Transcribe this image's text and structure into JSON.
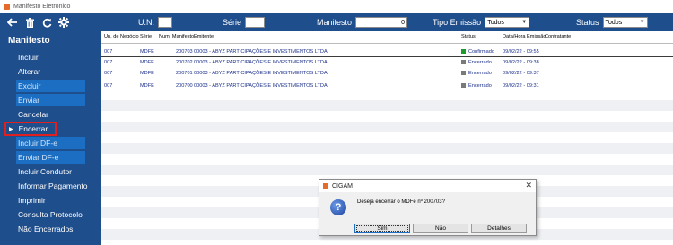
{
  "window": {
    "title": "Manifesto Eletrônico"
  },
  "toolbar": {
    "icons": [
      "back-arrow-icon",
      "trash-icon",
      "refresh-icon",
      "gear-icon"
    ],
    "un_label": "U.N.",
    "un_value": "",
    "serie_label": "Série",
    "serie_value": "",
    "manifesto_label": "Manifesto",
    "manifesto_value": "0",
    "tipo_label": "Tipo Emissão",
    "tipo_value": "Todos",
    "status_label": "Status",
    "status_value": "Todos",
    "accent_color": "#1f4e8c"
  },
  "sidebar": {
    "heading": "Manifesto",
    "items": [
      {
        "label": "Incluir",
        "state": "enabled"
      },
      {
        "label": "Alterar",
        "state": "enabled"
      },
      {
        "label": "Excluir",
        "state": "disabled"
      },
      {
        "label": "Enviar",
        "state": "disabled"
      },
      {
        "label": "Cancelar",
        "state": "enabled"
      },
      {
        "label": "Encerrar",
        "state": "active"
      },
      {
        "label": "Incluir DF-e",
        "state": "disabled"
      },
      {
        "label": "Enviar DF-e",
        "state": "disabled"
      },
      {
        "label": "Incluir Condutor",
        "state": "enabled"
      },
      {
        "label": "Informar Pagamento",
        "state": "enabled"
      },
      {
        "label": "Imprimir",
        "state": "enabled"
      },
      {
        "label": "Consulta Protocolo",
        "state": "enabled"
      },
      {
        "label": "Não Encerrados",
        "state": "enabled"
      }
    ]
  },
  "grid": {
    "columns": [
      "Un. de Negócio",
      "Série",
      "Num. Manifesto",
      "Emitente",
      "Status",
      "Data/Hora Emissão",
      "Contratante"
    ],
    "rows": [
      {
        "un": "007",
        "serie": "MDFE",
        "num": "200703",
        "emitente": "00003 - ABYZ PARTICIPAÇÕES E INVESTIMENTOS LTDA",
        "status": "Confirmado",
        "status_color": "#1e9a2e",
        "data": "09/02/22 - 09:55",
        "contratante": ""
      },
      {
        "un": "007",
        "serie": "MDFE",
        "num": "200702",
        "emitente": "00003 - ABYZ PARTICIPAÇÕES E INVESTIMENTOS LTDA",
        "status": "Encerrado",
        "status_color": "#7a7a7a",
        "data": "09/02/22 - 09:38",
        "contratante": ""
      },
      {
        "un": "007",
        "serie": "MDFE",
        "num": "200701",
        "emitente": "00003 - ABYZ PARTICIPAÇÕES E INVESTIMENTOS LTDA",
        "status": "Encerrado",
        "status_color": "#7a7a7a",
        "data": "09/02/22 - 09:37",
        "contratante": ""
      },
      {
        "un": "007",
        "serie": "MDFE",
        "num": "200700",
        "emitente": "00003 - ABYZ PARTICIPAÇÕES E INVESTIMENTOS LTDA",
        "status": "Encerrado",
        "status_color": "#7a7a7a",
        "data": "09/02/22 - 09:31",
        "contratante": ""
      }
    ]
  },
  "dialog": {
    "title": "CIGAM",
    "close": "✕",
    "icon": "question-icon",
    "message": "Deseja encerrar o MDFe nº 200703?",
    "buttons": [
      "Sim",
      "Não",
      "Detalhes"
    ]
  }
}
